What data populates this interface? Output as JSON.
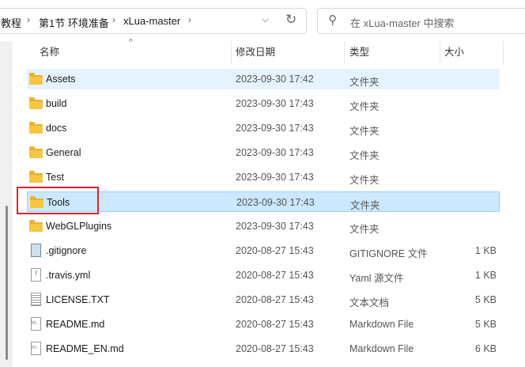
{
  "address": {
    "crumbs": [
      "教程",
      "第1节 环境准备",
      "xLua-master"
    ]
  },
  "search": {
    "placeholder": "在 xLua-master 中搜索"
  },
  "columns": {
    "name": "名称",
    "date": "修改日期",
    "type": "类型",
    "size": "大小"
  },
  "files": [
    {
      "name": "Assets",
      "date": "2023-09-30 17:42",
      "type": "文件夹",
      "size": "",
      "icon": "folder"
    },
    {
      "name": "build",
      "date": "2023-09-30 17:43",
      "type": "文件夹",
      "size": "",
      "icon": "folder"
    },
    {
      "name": "docs",
      "date": "2023-09-30 17:43",
      "type": "文件夹",
      "size": "",
      "icon": "folder"
    },
    {
      "name": "General",
      "date": "2023-09-30 17:43",
      "type": "文件夹",
      "size": "",
      "icon": "folder"
    },
    {
      "name": "Test",
      "date": "2023-09-30 17:43",
      "type": "文件夹",
      "size": "",
      "icon": "folder"
    },
    {
      "name": "Tools",
      "date": "2023-09-30 17:43",
      "type": "文件夹",
      "size": "",
      "icon": "folder"
    },
    {
      "name": "WebGLPlugins",
      "date": "2023-09-30 17:43",
      "type": "文件夹",
      "size": "",
      "icon": "folder"
    },
    {
      "name": ".gitignore",
      "date": "2020-08-27 15:43",
      "type": "GITIGNORE 文件",
      "size": "1 KB",
      "icon": "note"
    },
    {
      "name": ".travis.yml",
      "date": "2020-08-27 15:43",
      "type": "Yaml 源文件",
      "size": "1 KB",
      "icon": "yml"
    },
    {
      "name": "LICENSE.TXT",
      "date": "2020-08-27 15:43",
      "type": "文本文档",
      "size": "5 KB",
      "icon": "txt"
    },
    {
      "name": "README.md",
      "date": "2020-08-27 15:43",
      "type": "Markdown File",
      "size": "5 KB",
      "icon": "md"
    },
    {
      "name": "README_EN.md",
      "date": "2020-08-27 15:43",
      "type": "Markdown File",
      "size": "6 KB",
      "icon": "md"
    }
  ]
}
